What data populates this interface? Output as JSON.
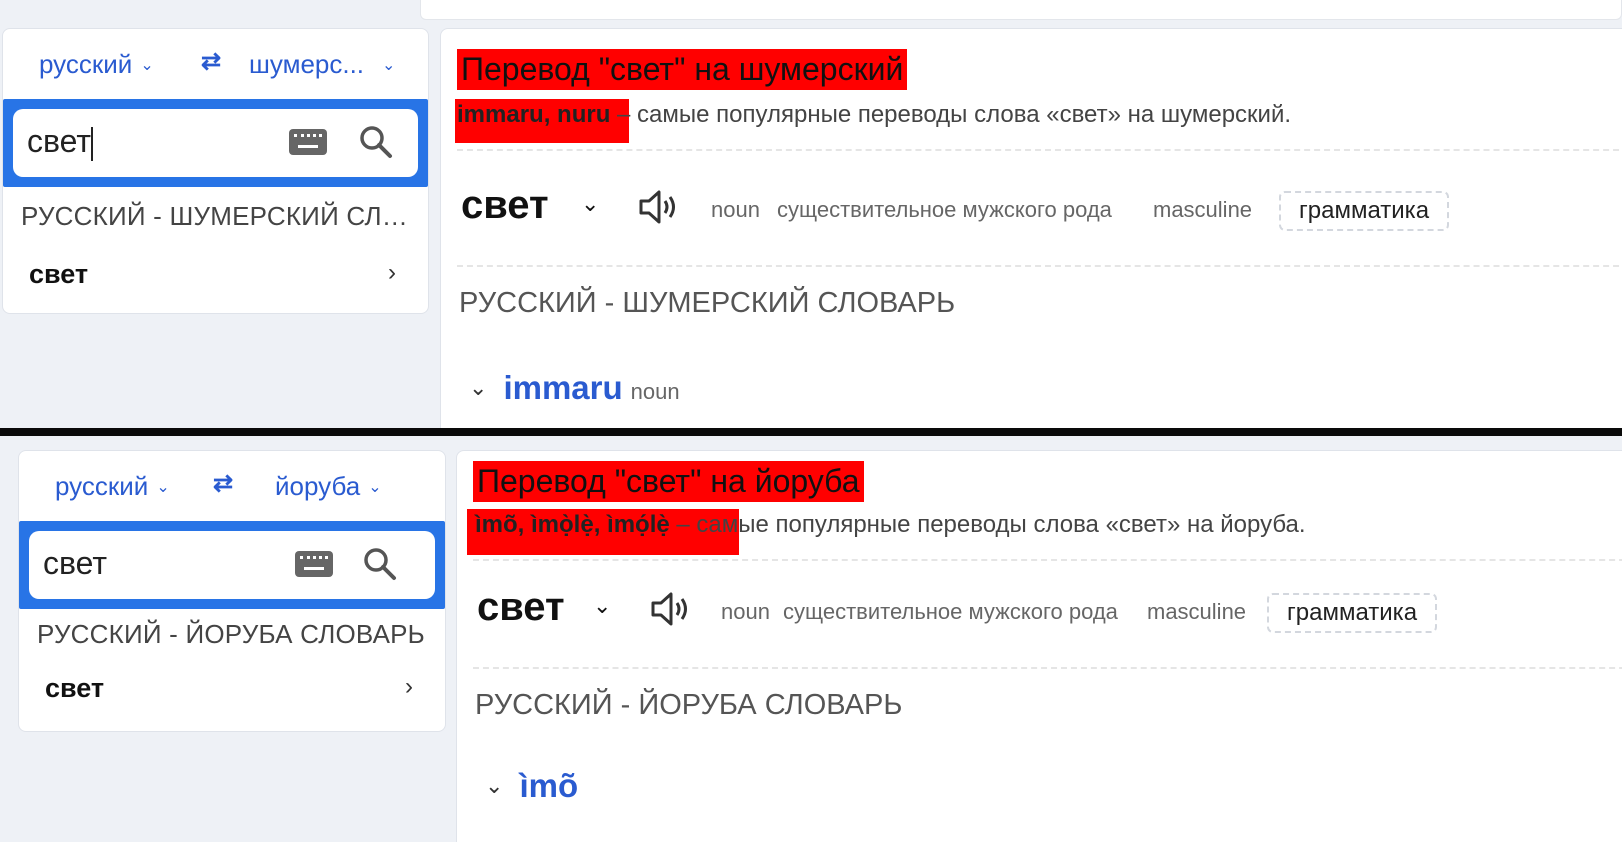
{
  "panels": [
    {
      "from_lang": "русский",
      "to_lang": "шумерс...",
      "search_value": "свет",
      "dict_heading": "РУССКИЙ - ШУМЕРСКИЙ СЛО...",
      "suggest_word": "свет",
      "title": "Перевод \"свет\" на шумерский",
      "top_translations": "immaru, nuru",
      "summary": " – самые популярные переводы слова «свет» на шумерский.",
      "entry_word": "свет",
      "tag_pos": "noun",
      "tag_desc": "существительное мужского рода",
      "tag_gender": "masculine",
      "grammar_label": "грамматика",
      "section_title": "РУССКИЙ - ШУМЕРСКИЙ СЛОВАРЬ",
      "translation_word": "immaru",
      "translation_pos": "noun"
    },
    {
      "from_lang": "русский",
      "to_lang": "йоруба",
      "search_value": "свет",
      "dict_heading": "РУССКИЙ - ЙОРУБА СЛОВАРЬ",
      "suggest_word": "свет",
      "title": "Перевод \"свет\" на йоруба",
      "top_translations": "ìmõ, ìmọ̀lẹ̀, ìmọ́lẹ̀",
      "summary": " – самые популярные переводы слова «свет» на йоруба.",
      "entry_word": "свет",
      "tag_pos": "noun",
      "tag_desc": "существительное мужского рода",
      "tag_gender": "masculine",
      "grammar_label": "грамматика",
      "section_title": "РУССКИЙ - ЙОРУБА СЛОВАРЬ",
      "translation_word": "ìmõ",
      "translation_pos": ""
    }
  ],
  "icons": {
    "swap": "swap-arrows-icon",
    "keyboard": "keyboard-icon",
    "search": "search-icon",
    "speaker": "speaker-icon",
    "chevron": "chevron-down-icon",
    "arrow": "chevron-right-icon"
  },
  "colors": {
    "accent": "#2a5bd0",
    "search_border": "#2874e6",
    "highlight": "#ff0000",
    "background": "#eef1f6"
  }
}
